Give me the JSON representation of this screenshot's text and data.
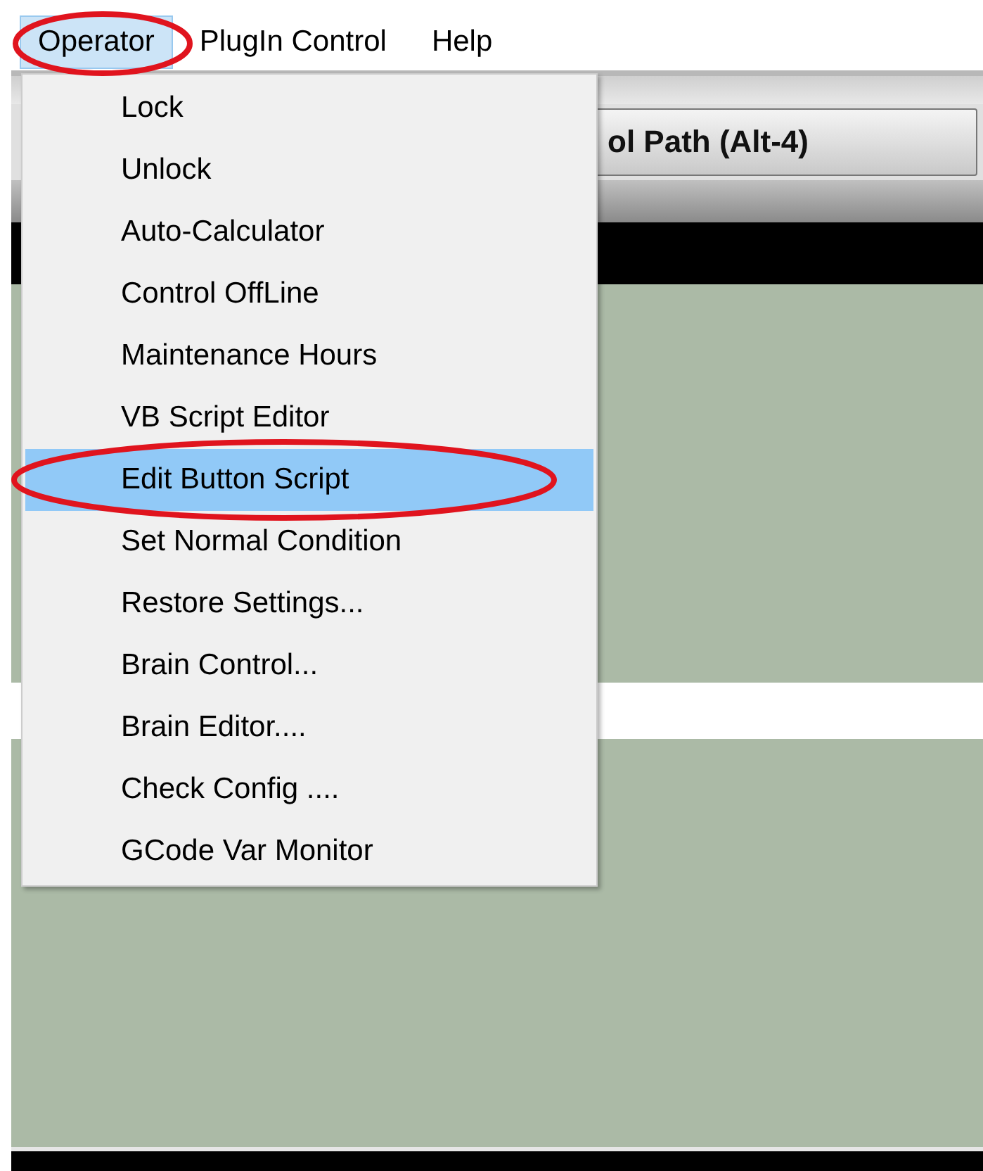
{
  "menubar": [
    {
      "label": "Operator",
      "selected": true
    },
    {
      "label": "PlugIn Control",
      "selected": false
    },
    {
      "label": "Help",
      "selected": false
    }
  ],
  "toolbar_button": {
    "label": "ol Path (Alt-4)"
  },
  "dropdown": {
    "items": [
      {
        "label": "Lock",
        "selected": false
      },
      {
        "label": "Unlock",
        "selected": false
      },
      {
        "label": "Auto-Calculator",
        "selected": false
      },
      {
        "label": "Control OffLine",
        "selected": false
      },
      {
        "label": "Maintenance Hours",
        "selected": false
      },
      {
        "label": "VB Script Editor",
        "selected": false
      },
      {
        "label": "Edit Button Script",
        "selected": true
      },
      {
        "label": "Set Normal Condition",
        "selected": false
      },
      {
        "label": "Restore Settings...",
        "selected": false
      },
      {
        "label": "Brain Control...",
        "selected": false
      },
      {
        "label": "Brain Editor....",
        "selected": false
      },
      {
        "label": "Check Config ....",
        "selected": false
      },
      {
        "label": "GCode Var Monitor",
        "selected": false
      }
    ]
  }
}
